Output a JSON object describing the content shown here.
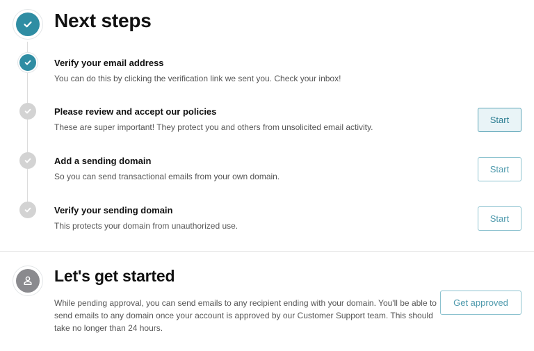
{
  "header": {
    "title": "Next steps"
  },
  "steps": [
    {
      "title": "Verify your email address",
      "desc": "You can do this by clicking the verification link we sent you. Check your inbox!",
      "status": "done"
    },
    {
      "title": "Please review and accept our policies",
      "desc": "These are super important! They protect you and others from unsolicited email activity.",
      "status": "todo",
      "button": "Start"
    },
    {
      "title": "Add a sending domain",
      "desc": "So you can send transactional emails from your own domain.",
      "status": "todo",
      "button": "Start"
    },
    {
      "title": "Verify your sending domain",
      "desc": "This protects your domain from unauthorized use.",
      "status": "todo",
      "button": "Start"
    }
  ],
  "getstarted": {
    "title": "Let's get started",
    "desc": "While pending approval, you can send emails to any recipient ending with your domain. You'll be able to send emails to any domain once your account is approved by our Customer Support team. This should take no longer than 24 hours.",
    "button": "Get approved"
  },
  "icons": {
    "check": "check-icon",
    "user": "user-icon"
  },
  "colors": {
    "accent": "#2f8da3",
    "muted": "#d3d3d3",
    "button_text": "#4f9aad"
  }
}
